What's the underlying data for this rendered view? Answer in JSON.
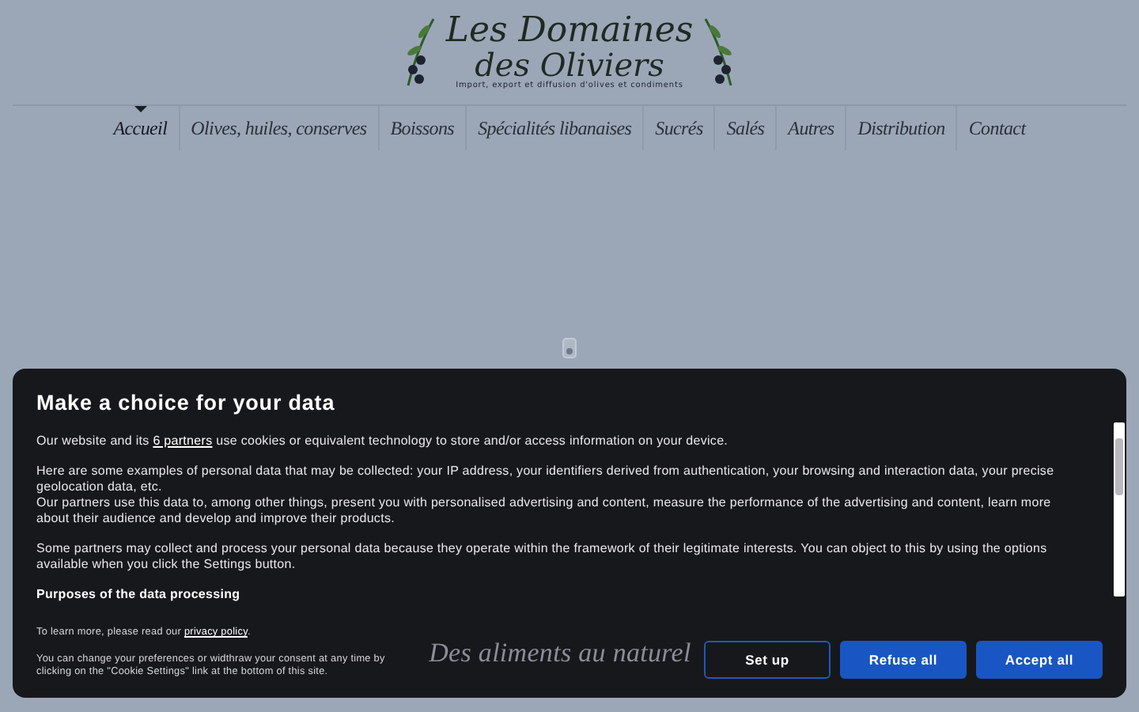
{
  "logo": {
    "title_line_1": "Les Domaines",
    "title_line_2": "des Oliviers",
    "tagline": "Import, export et diffusion d'olives et condiments"
  },
  "nav": [
    {
      "label": "Accueil",
      "selected": true
    },
    {
      "label": "Olives, huiles, conserves",
      "selected": false
    },
    {
      "label": "Boissons",
      "selected": false
    },
    {
      "label": "Spécialités libanaises",
      "selected": false
    },
    {
      "label": "Sucrés",
      "selected": false
    },
    {
      "label": "Salés",
      "selected": false
    },
    {
      "label": "Autres",
      "selected": false
    },
    {
      "label": "Distribution",
      "selected": false
    },
    {
      "label": "Contact",
      "selected": false
    }
  ],
  "hero_heading": "Des aliments au naturel",
  "consent": {
    "title": "Make a choice for your data",
    "paragraphs": [
      {
        "before": "Our website and its ",
        "link": "6 partners",
        "after": " use cookies or equivalent technology to store and/or access information on your device."
      },
      {
        "text": "Here are some examples of personal data that may be collected: your IP address, your identifiers derived from authentication, your browsing and interaction data, your precise geolocation data, etc."
      },
      {
        "text": "Our partners use this data to, among other things, present you with personalised advertising and content, measure the performance of the advertising and content, learn more about their audience and develop and improve their products."
      },
      {
        "text": "Some partners may collect and process your personal data because they operate within the framework of their legitimate interests. You can object to this by using the options available when you click the Settings button."
      }
    ],
    "purposes_title": "Purposes of the data processing",
    "learn_more": {
      "before": "To learn more, please read our ",
      "link": "privacy policy",
      "after": "."
    },
    "change_note": "You can change your preferences or widthraw your consent at any time by clicking on the \"Cookie Settings\" link at the bottom of this site.",
    "buttons": [
      {
        "label": "Set up",
        "kind": "outline"
      },
      {
        "label": "Refuse all",
        "kind": "filled"
      },
      {
        "label": "Accept all",
        "kind": "filled"
      }
    ]
  }
}
